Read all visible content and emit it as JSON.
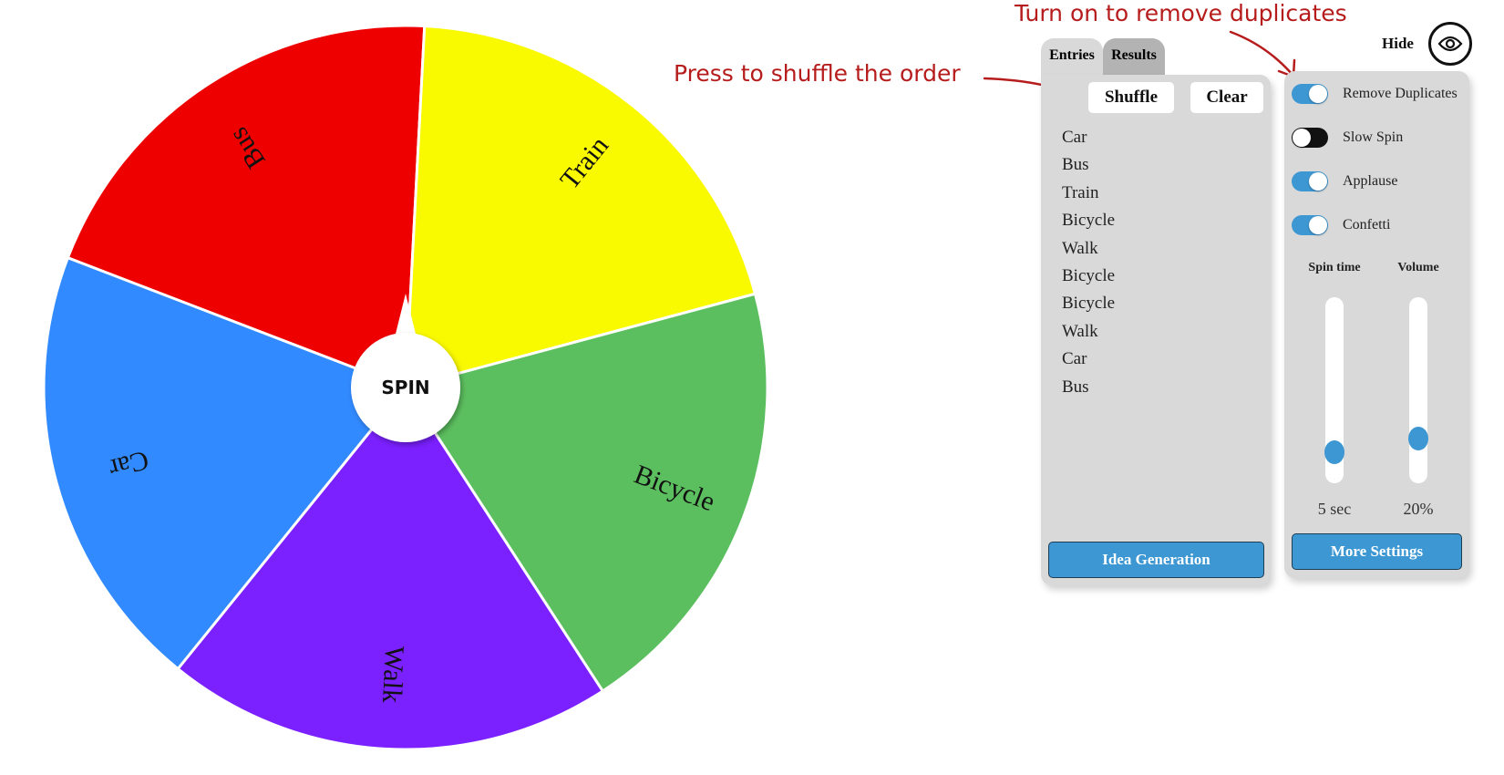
{
  "wheel": {
    "segments": [
      {
        "label": "Bus",
        "color": "#ee0000"
      },
      {
        "label": "Train",
        "color": "#f9f900"
      },
      {
        "label": "Bicycle",
        "color": "#5cbf5f"
      },
      {
        "label": "Walk",
        "color": "#7b20ff"
      },
      {
        "label": "Car",
        "color": "#318aff"
      }
    ],
    "spin_label": "SPIN"
  },
  "annotations": {
    "shuffle_hint": "Press to shuffle the order",
    "duplicates_hint": "Turn on to remove duplicates",
    "color": "#b71c1c"
  },
  "tabs": {
    "entries": "Entries",
    "results": "Results"
  },
  "entries_panel": {
    "shuffle_label": "Shuffle",
    "clear_label": "Clear",
    "items": [
      "Car",
      "Bus",
      "Train",
      "Bicycle",
      "Walk",
      "Bicycle",
      "Bicycle",
      "Walk",
      "Car",
      "Bus"
    ],
    "idea_button": "Idea Generation"
  },
  "settings": {
    "hide_label": "Hide",
    "hide_icon": "eye-icon",
    "toggles": [
      {
        "label": "Remove Duplicates",
        "on": true
      },
      {
        "label": "Slow Spin",
        "on": false
      },
      {
        "label": "Applause",
        "on": true
      },
      {
        "label": "Confetti",
        "on": true
      }
    ],
    "spin_time": {
      "label": "Spin time",
      "value": "5 sec",
      "level": 0.12
    },
    "volume": {
      "label": "Volume",
      "value": "20%",
      "level": 0.2
    },
    "more_button": "More Settings",
    "accent_color": "#3d97d3"
  }
}
